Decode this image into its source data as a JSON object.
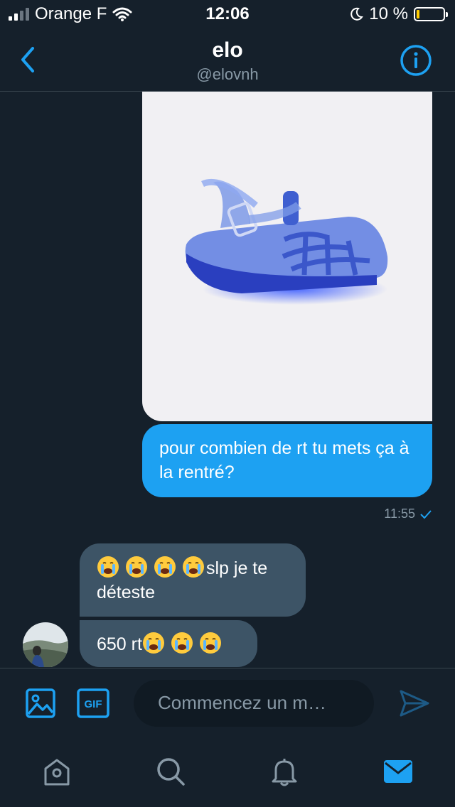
{
  "status_bar": {
    "carrier": "Orange F",
    "time": "12:06",
    "battery_percent": "10 %",
    "battery_level": 0.1
  },
  "header": {
    "title": "elo",
    "handle": "@elovnh"
  },
  "messages": {
    "outgoing_text": "pour combien de rt tu mets ça à la rentré?",
    "outgoing_time": "11:55",
    "incoming_1_text": "slp je te déteste",
    "incoming_2_text": "650 rt"
  },
  "composer": {
    "gif_label": "GIF",
    "placeholder": "Commencez un m…"
  },
  "icons": {
    "back": "chevron-left-icon",
    "info": "info-icon",
    "image": "image-icon",
    "gif": "gif-icon",
    "send": "send-icon",
    "home": "home-icon",
    "search": "search-icon",
    "notifications": "bell-icon",
    "messages": "mail-icon",
    "emoji": "loudly-crying-face-emoji"
  },
  "colors": {
    "background": "#15202b",
    "accent": "#1da1f2",
    "incoming_bubble": "#3d5466",
    "muted_text": "#8899a6",
    "divider": "#38444d"
  }
}
